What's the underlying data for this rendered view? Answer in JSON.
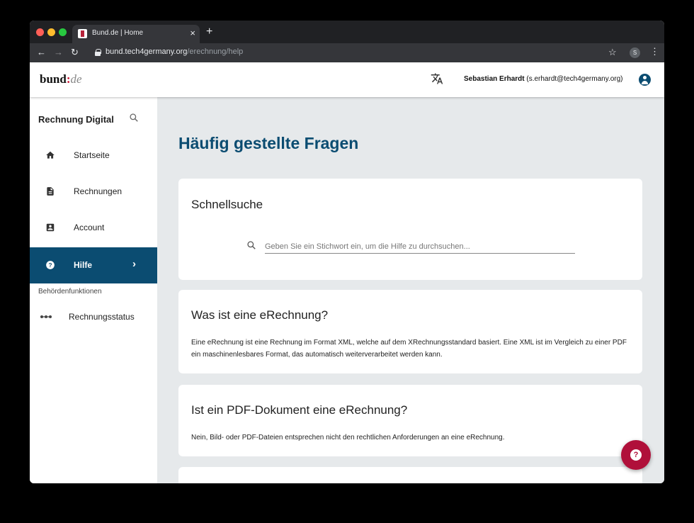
{
  "browser": {
    "tab_title": "Bund.de | Home",
    "tab_close": "×",
    "new_tab": "+",
    "url_host": "bund.tech4germany.org",
    "url_path": "/erechnung/help",
    "profile_initial": "S",
    "traffic_colors": [
      "#ff5f57",
      "#febc2e",
      "#28c840"
    ]
  },
  "header": {
    "logo_main": "bund",
    "logo_colon": ":",
    "logo_suffix": "de",
    "user_name": "Sebastian Erhardt",
    "user_email": "(s.erhardt@tech4germany.org)"
  },
  "sidebar": {
    "title": "Rechnung Digital",
    "items": [
      {
        "label": "Startseite",
        "icon": "home-icon"
      },
      {
        "label": "Rechnungen",
        "icon": "document-icon"
      },
      {
        "label": "Account",
        "icon": "account-box-icon"
      },
      {
        "label": "Hilfe",
        "icon": "help-icon",
        "active": true
      }
    ],
    "section_label": "Behördenfunktionen",
    "status_item": {
      "label": "Rechnungsstatus",
      "icon": "timeline-icon"
    }
  },
  "main": {
    "title": "Häufig gestellte Fragen",
    "quicksearch": {
      "heading": "Schnellsuche",
      "placeholder": "Geben Sie ein Stichwort ein, um die Hilfe zu durchsuchen..."
    },
    "faqs": [
      {
        "question": "Was ist eine eRechnung?",
        "answer": "Eine eRechnung ist eine Rechnung im Format XML, welche auf dem XRechnungsstandard basiert. Eine XML ist im Vergleich zu einer PDF ein maschinenlesbares Format, das automatisch weiterverarbeitet werden kann."
      },
      {
        "question": "Ist ein PDF-Dokument eine eRechnung?",
        "answer": "Nein, Bild- oder PDF-Dateien entsprechen nicht den rechtlichen Anforderungen an eine eRechnung."
      }
    ],
    "help_fab": "?"
  },
  "colors": {
    "primary": "#0b4c71",
    "accent": "#b0103a",
    "background": "#e6e9eb"
  }
}
